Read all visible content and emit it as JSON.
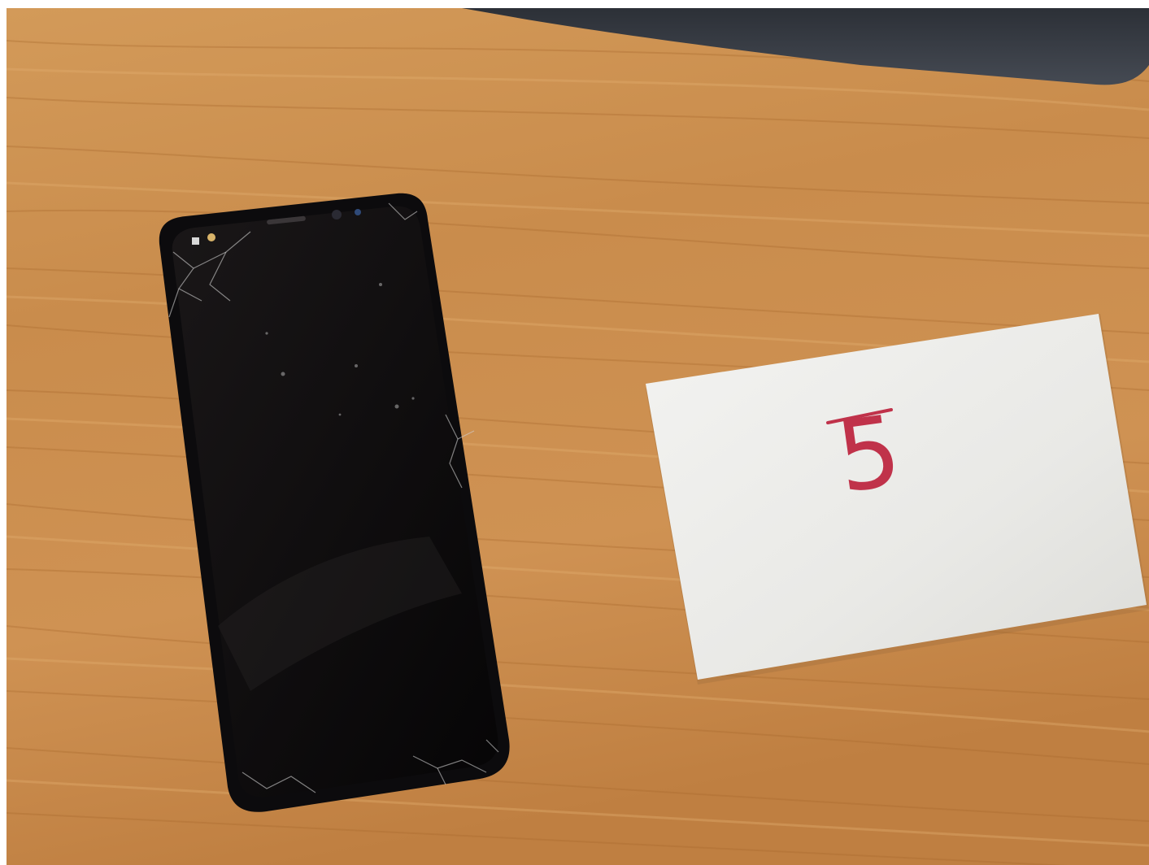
{
  "scene": {
    "colors": {
      "wood_base": "#c88a4a",
      "wood_light": "#d9a263",
      "wood_dark": "#a8692f",
      "keyboard": "#3a3f47",
      "phone_body": "#0c0b0d",
      "card": "#eeeeec",
      "ink": "#c0324a"
    },
    "note_card": {
      "handwritten_text": "5"
    }
  }
}
